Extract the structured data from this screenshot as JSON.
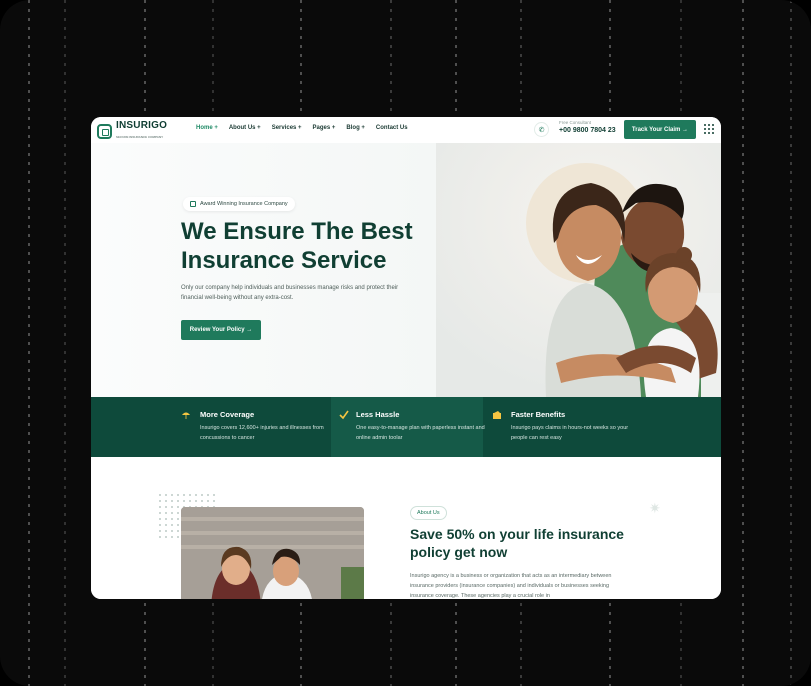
{
  "brand": {
    "name": "INSURIGO",
    "tagline": "SECURE INSURANCE COMPANY"
  },
  "nav": {
    "items": [
      "Home +",
      "About Us +",
      "Services +",
      "Pages +",
      "Blog +",
      "Contact Us"
    ],
    "active_index": 0,
    "consult_label": "Free Consultant",
    "consult_phone": "+00 9800 7804 23",
    "track_button": "Track Your Claim →"
  },
  "hero": {
    "badge": "Award Winning Insurance Company",
    "title_line1": "We Ensure The Best",
    "title_line2": "Insurance Service",
    "description": "Only our company help individuals and businesses manage risks and protect their financial well-being without any extra-cost.",
    "cta": "Review Your Policy →"
  },
  "features": [
    {
      "icon": "umbrella-icon",
      "title": "More Coverage",
      "text": "Insurigo covers 12,600+ injuries and illnesses from concussions to cancer"
    },
    {
      "icon": "checkmark-icon",
      "title": "Less Hassle",
      "text": "One easy-to-manage plan with paperless instant and online admin toolar"
    },
    {
      "icon": "wallet-icon",
      "title": "Faster Benefits",
      "text": "Insurigo pays claims in hours-not weeks so your people can rest easy"
    }
  ],
  "about": {
    "pill": "About Us",
    "title": "Save 50% on your life insurance policy get now",
    "text": "Insurigo agency is a business or organization that acts as an intermediary between insurance providers (insurance companies) and individuals or businesses seeking insurance coverage. These agencies play a crucial role in"
  },
  "colors": {
    "primary": "#1f7a5c",
    "dark": "#0e4a3b",
    "heading": "#103f33"
  }
}
